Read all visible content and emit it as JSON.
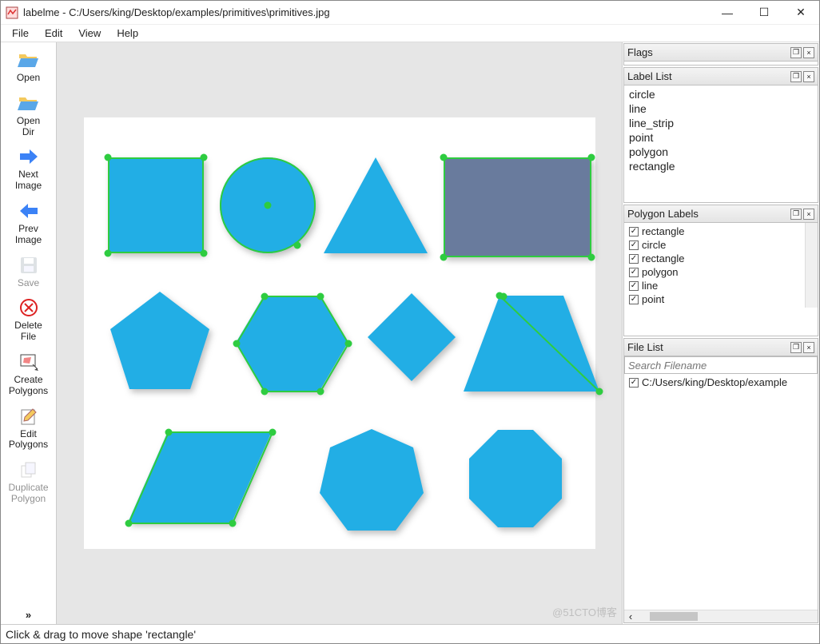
{
  "titlebar": {
    "app": "labelme",
    "sep": " - ",
    "path": "C:/Users/king/Desktop/examples/primitives\\primitives.jpg",
    "min": "—",
    "max": "☐",
    "close": "✕"
  },
  "menubar": [
    "File",
    "Edit",
    "View",
    "Help"
  ],
  "toolbar": [
    {
      "id": "open",
      "label": "Open"
    },
    {
      "id": "open-dir",
      "label": "Open\nDir"
    },
    {
      "id": "next-image",
      "label": "Next\nImage"
    },
    {
      "id": "prev-image",
      "label": "Prev\nImage"
    },
    {
      "id": "save",
      "label": "Save",
      "disabled": true
    },
    {
      "id": "delete-file",
      "label": "Delete\nFile"
    },
    {
      "id": "create-polygons",
      "label": "Create\nPolygons"
    },
    {
      "id": "edit-polygons",
      "label": "Edit\nPolygons"
    },
    {
      "id": "duplicate-polygon",
      "label": "Duplicate\nPolygon",
      "disabled": true
    }
  ],
  "panels": {
    "flags": {
      "title": "Flags"
    },
    "labellist": {
      "title": "Label List",
      "items": [
        "circle",
        "line",
        "line_strip",
        "point",
        "polygon",
        "rectangle"
      ]
    },
    "polylabels": {
      "title": "Polygon Labels",
      "items": [
        {
          "label": "rectangle",
          "checked": true
        },
        {
          "label": "circle",
          "checked": true
        },
        {
          "label": "rectangle",
          "checked": true
        },
        {
          "label": "polygon",
          "checked": true
        },
        {
          "label": "line",
          "checked": true
        },
        {
          "label": "point",
          "checked": true
        }
      ]
    },
    "filelist": {
      "title": "File List",
      "search_placeholder": "Search Filename",
      "items": [
        {
          "label": "C:/Users/king/Desktop/example",
          "checked": true
        }
      ]
    }
  },
  "statusbar": "Click & drag to move shape 'rectangle'",
  "watermark": "@51CTO博客",
  "panel_controls": {
    "pop": "❐",
    "close": "×"
  }
}
